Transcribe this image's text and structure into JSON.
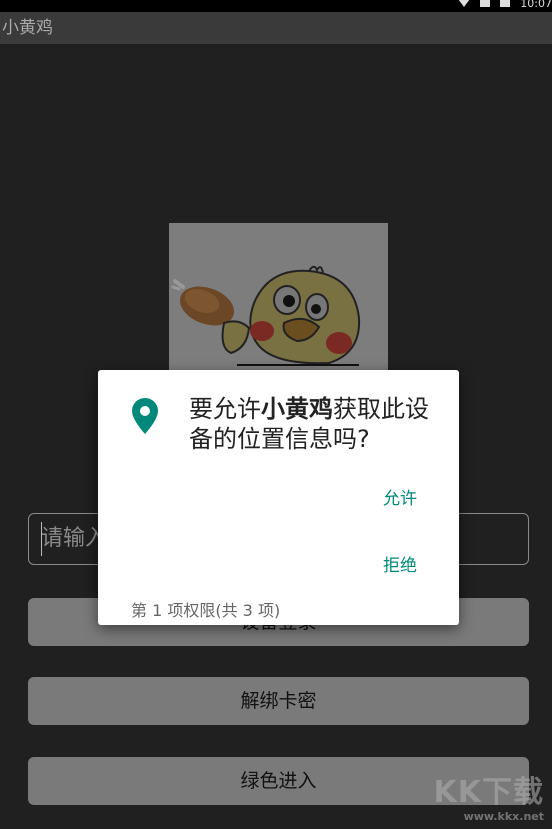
{
  "status": {
    "time": "10:07"
  },
  "app": {
    "title": "小黄鸡"
  },
  "input": {
    "placeholder": "请输入"
  },
  "buttons": {
    "login": "设备登录",
    "unbind": "解绑卡密",
    "green": "绿色进入"
  },
  "dialog": {
    "msg_prefix": "要允许",
    "app_name": "小黄鸡",
    "msg_suffix": "获取此设备的位置信息吗?",
    "allow": "允许",
    "deny": "拒绝",
    "footer": "第 1 项权限(共 3 项)",
    "accent": "#00897b"
  },
  "watermark": {
    "brand": "KK下载",
    "url": "www.kkx.net"
  }
}
